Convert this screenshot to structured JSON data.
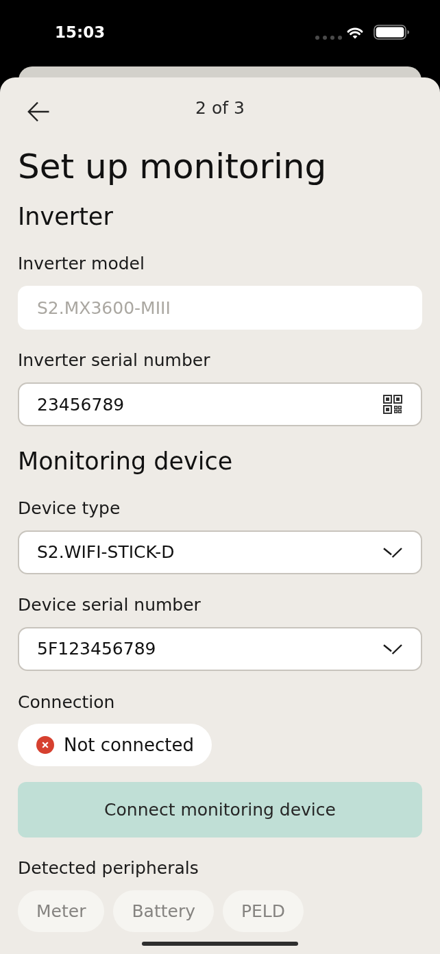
{
  "status_bar": {
    "time": "15:03"
  },
  "nav": {
    "step": "2 of 3"
  },
  "title": "Set up monitoring",
  "sections": [
    {
      "heading": "Inverter",
      "fields": [
        {
          "label": "Inverter model",
          "kind": "text",
          "value": "S2.MX3600-MIII",
          "disabled": true
        },
        {
          "label": "Inverter serial number",
          "kind": "scan",
          "value": "23456789",
          "disabled": false
        }
      ]
    },
    {
      "heading": "Monitoring device",
      "fields": [
        {
          "label": "Device type",
          "kind": "select",
          "value": "S2.WIFI-STICK-D",
          "disabled": false
        },
        {
          "label": "Device serial number",
          "kind": "select",
          "value": "5F123456789",
          "disabled": false
        }
      ]
    }
  ],
  "connection": {
    "label": "Connection",
    "status": "Not connected",
    "connected": false
  },
  "connect_button": {
    "label": "Connect monitoring device"
  },
  "peripherals": {
    "label": "Detected peripherals",
    "items": [
      {
        "label": "Meter",
        "detected": false
      },
      {
        "label": "Battery",
        "detected": false
      },
      {
        "label": "PELD",
        "detected": false
      }
    ]
  }
}
